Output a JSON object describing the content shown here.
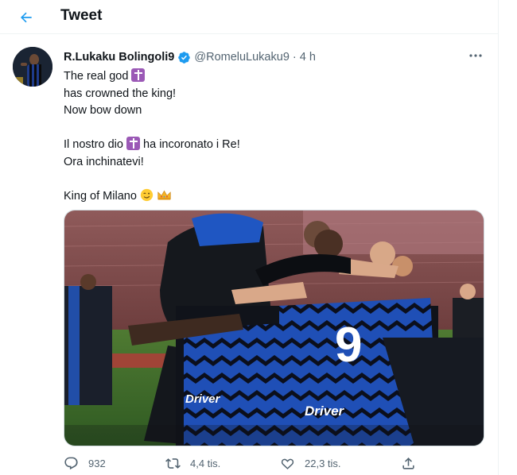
{
  "header": {
    "title": "Tweet",
    "back_icon": "arrow-left-icon"
  },
  "tweet": {
    "author": {
      "display_name": "R.Lukaku Bolingoli9",
      "handle": "@RomeluLukaku9",
      "separator": "·",
      "time": "4 h",
      "verified": true
    },
    "lines": [
      {
        "text": "The real god",
        "emoji_after": "latin-cross-emoji"
      },
      {
        "text": "has crowned the king!"
      },
      {
        "text": "Now bow down"
      },
      {
        "text": ""
      },
      {
        "text_before": "Il nostro dio",
        "emoji_mid": "latin-cross-emoji",
        "text_after": "ha incoronato i Re!"
      },
      {
        "text": "Ora inchinatevi!"
      },
      {
        "text": ""
      },
      {
        "text": "King of Milano",
        "emojis_after": [
          "winking-face-emoji",
          "crown-emoji"
        ]
      }
    ],
    "media": {
      "alt": "",
      "jersey_number": "9",
      "sponsor": "Driver"
    },
    "stats": {
      "replies": "932",
      "retweets": "4,4 tis.",
      "likes": "22,3 tis."
    }
  },
  "colors": {
    "accent": "#1d9bf0",
    "text": "#0f1419",
    "secondary": "#536471",
    "border": "#eff3f4"
  }
}
